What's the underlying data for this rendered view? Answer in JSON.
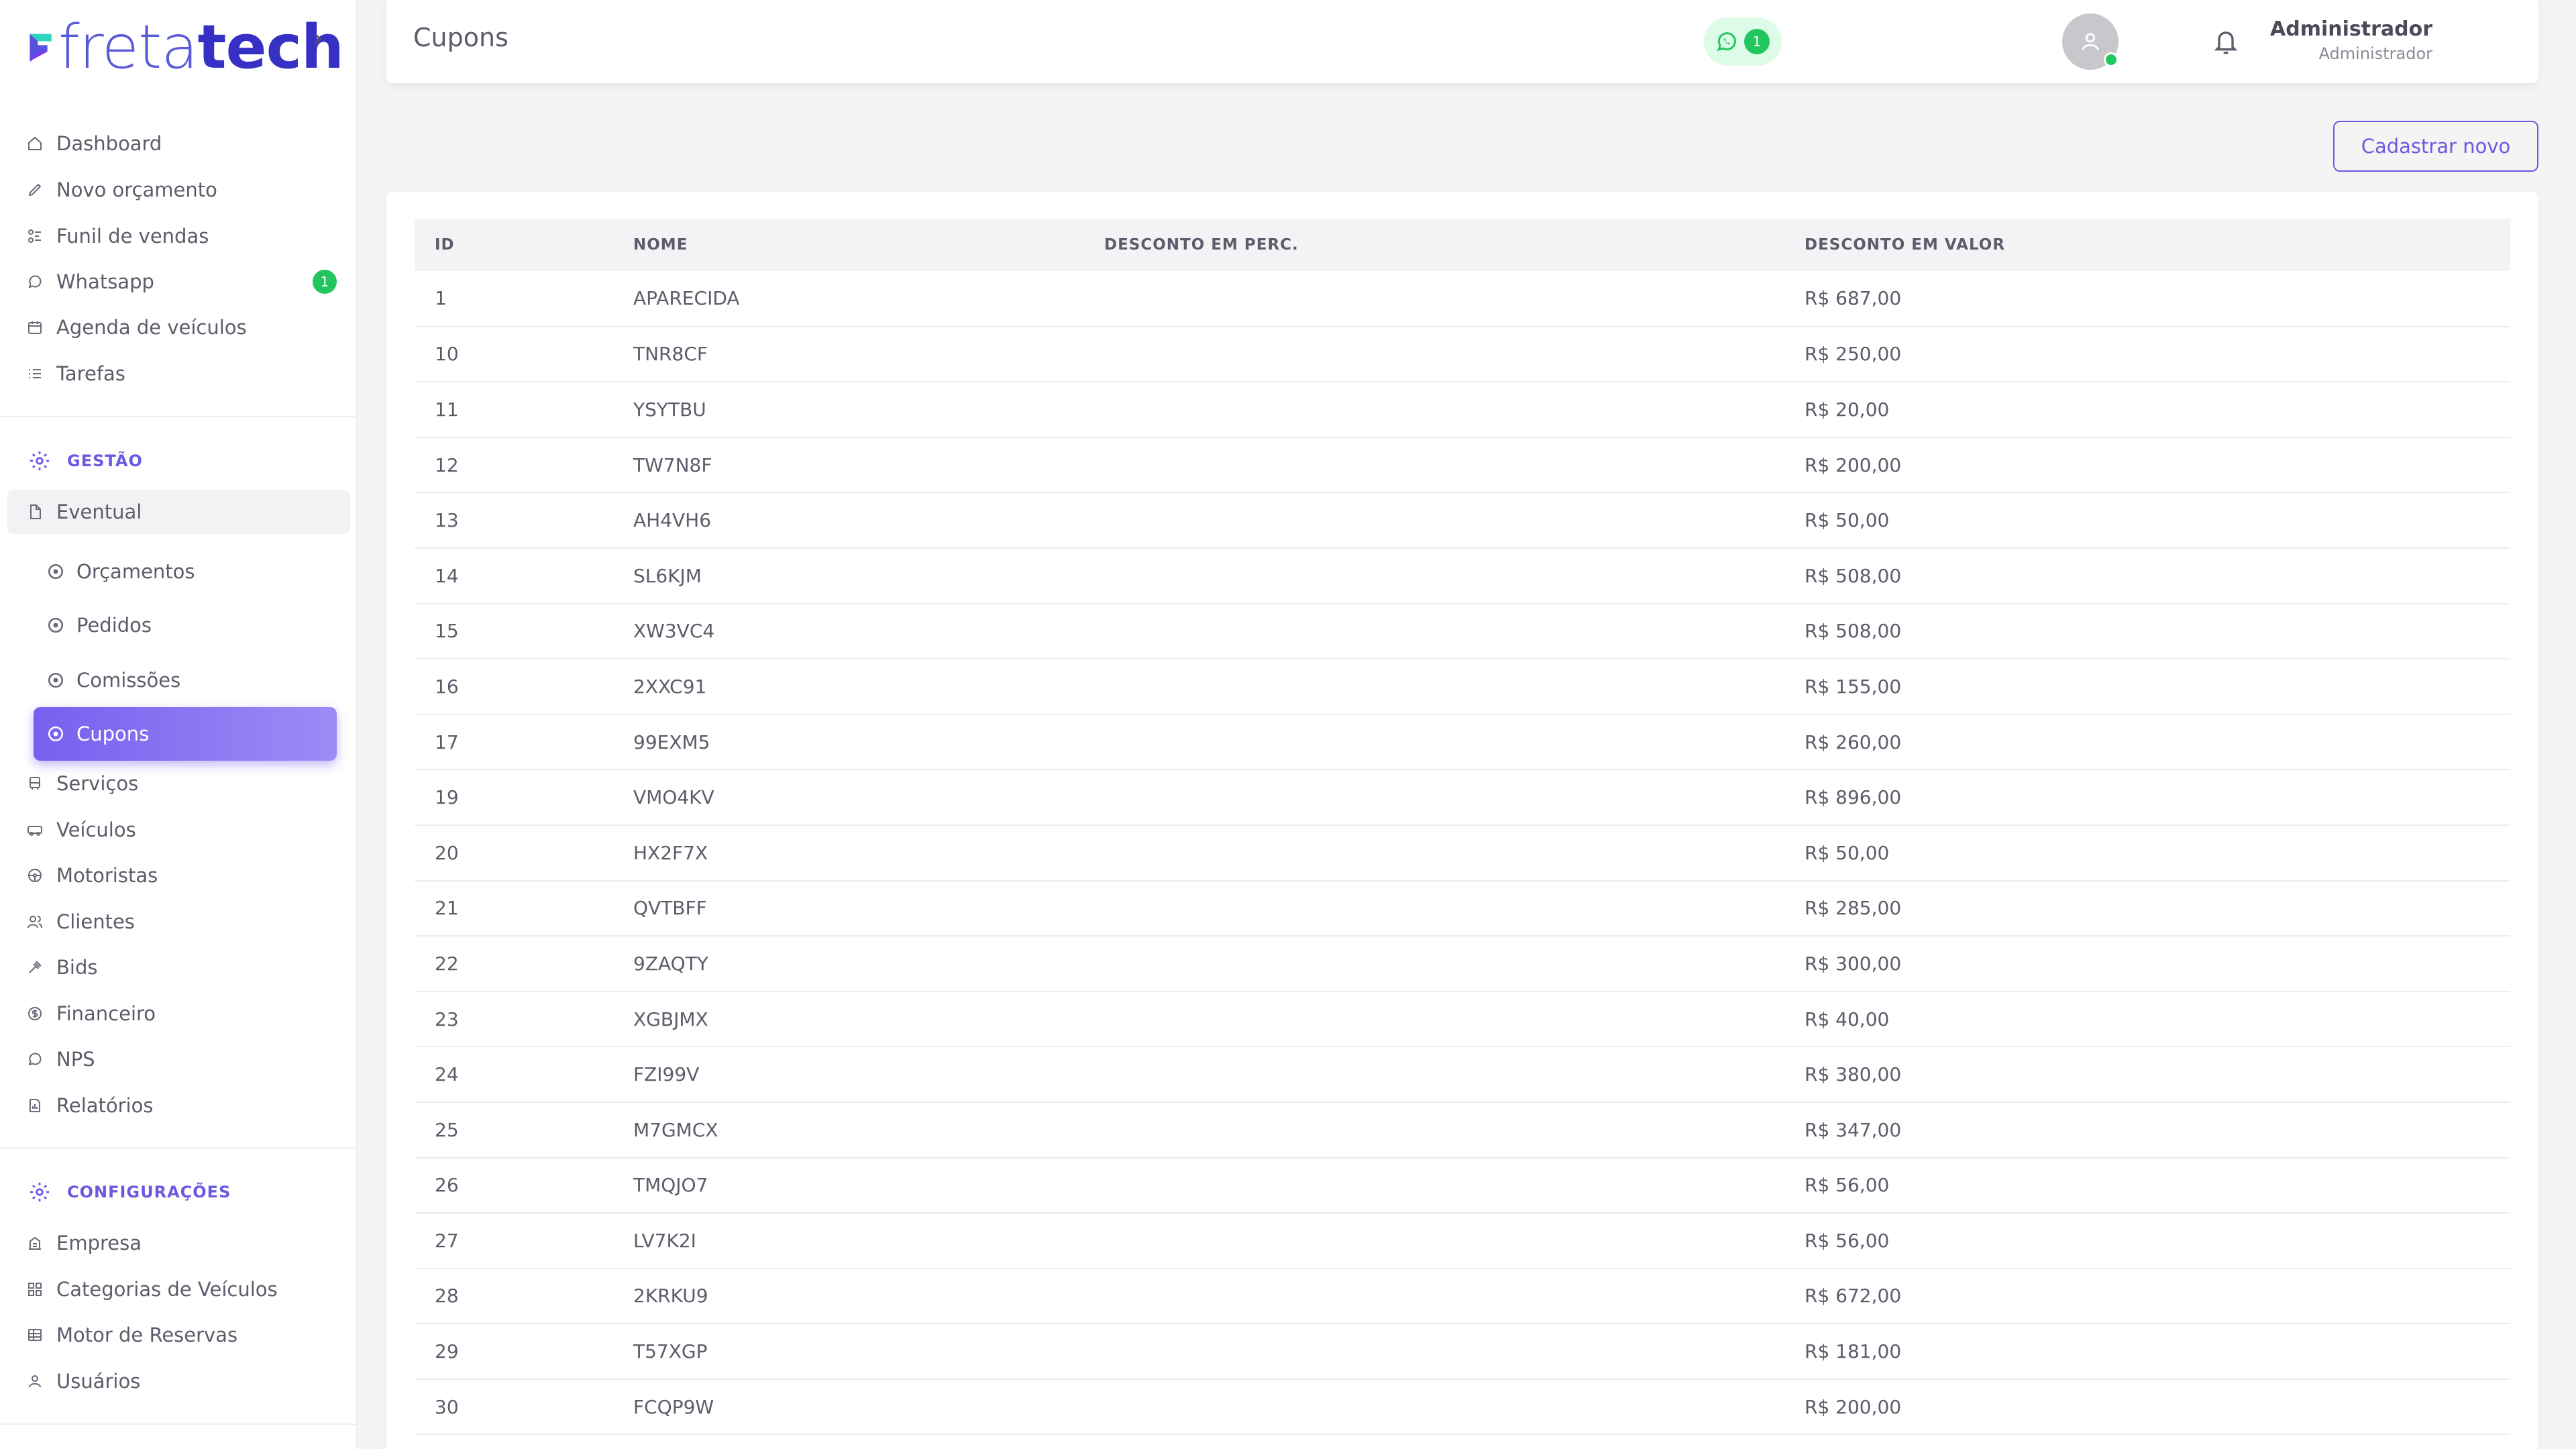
{
  "brand": {
    "name_part1": "freta",
    "name_part2": "tech",
    "accent": "#6a5ae0"
  },
  "sidebar": {
    "main_items": [
      {
        "label": "Dashboard",
        "icon": "home-icon"
      },
      {
        "label": "Novo orçamento",
        "icon": "edit-icon"
      },
      {
        "label": "Funil de vendas",
        "icon": "funnel-icon"
      },
      {
        "label": "Whatsapp",
        "icon": "whatsapp-icon",
        "badge": "1"
      },
      {
        "label": "Agenda de veículos",
        "icon": "calendar-icon"
      },
      {
        "label": "Tarefas",
        "icon": "list-icon"
      }
    ],
    "section_gestao": "GESTÃO",
    "eventual": "Eventual",
    "eventual_sub": [
      {
        "label": "Orçamentos",
        "icon": "circle-icon"
      },
      {
        "label": "Pedidos",
        "icon": "circle-icon"
      },
      {
        "label": "Comissões",
        "icon": "circle-icon"
      },
      {
        "label": "Cupons",
        "icon": "circle-icon",
        "active": true
      }
    ],
    "gestao_items": [
      {
        "label": "Serviços",
        "icon": "bus-icon"
      },
      {
        "label": "Veículos",
        "icon": "car-icon"
      },
      {
        "label": "Motoristas",
        "icon": "steering-wheel-icon"
      },
      {
        "label": "Clientes",
        "icon": "users-icon"
      },
      {
        "label": "Bids",
        "icon": "gavel-icon"
      },
      {
        "label": "Financeiro",
        "icon": "dollar-icon"
      },
      {
        "label": "NPS",
        "icon": "chat-icon"
      },
      {
        "label": "Relatórios",
        "icon": "report-icon"
      }
    ],
    "section_config": "CONFIGURAÇÕES",
    "config_items": [
      {
        "label": "Empresa",
        "icon": "building-icon"
      },
      {
        "label": "Categorias de Veículos",
        "icon": "grid-icon"
      },
      {
        "label": "Motor de Reservas",
        "icon": "table-icon"
      },
      {
        "label": "Usuários",
        "icon": "user-icon"
      }
    ]
  },
  "header": {
    "title": "Cupons",
    "whatsapp_count": "1",
    "user_name": "Administrador",
    "user_role": "Administrador"
  },
  "actions": {
    "new_button": "Cadastrar novo"
  },
  "table": {
    "columns": [
      "ID",
      "NOME",
      "DESCONTO EM PERC.",
      "DESCONTO EM VALOR"
    ],
    "rows": [
      [
        "1",
        "APARECIDA",
        "",
        "R$ 687,00"
      ],
      [
        "10",
        "TNR8CF",
        "",
        "R$ 250,00"
      ],
      [
        "11",
        "YSYTBU",
        "",
        "R$ 20,00"
      ],
      [
        "12",
        "TW7N8F",
        "",
        "R$ 200,00"
      ],
      [
        "13",
        "AH4VH6",
        "",
        "R$ 50,00"
      ],
      [
        "14",
        "SL6KJM",
        "",
        "R$ 508,00"
      ],
      [
        "15",
        "XW3VC4",
        "",
        "R$ 508,00"
      ],
      [
        "16",
        "2XXC91",
        "",
        "R$ 155,00"
      ],
      [
        "17",
        "99EXM5",
        "",
        "R$ 260,00"
      ],
      [
        "19",
        "VMO4KV",
        "",
        "R$ 896,00"
      ],
      [
        "20",
        "HX2F7X",
        "",
        "R$ 50,00"
      ],
      [
        "21",
        "QVTBFF",
        "",
        "R$ 285,00"
      ],
      [
        "22",
        "9ZAQTY",
        "",
        "R$ 300,00"
      ],
      [
        "23",
        "XGBJMX",
        "",
        "R$ 40,00"
      ],
      [
        "24",
        "FZI99V",
        "",
        "R$ 380,00"
      ],
      [
        "25",
        "M7GMCX",
        "",
        "R$ 347,00"
      ],
      [
        "26",
        "TMQJO7",
        "",
        "R$ 56,00"
      ],
      [
        "27",
        "LV7K2I",
        "",
        "R$ 56,00"
      ],
      [
        "28",
        "2KRKU9",
        "",
        "R$ 672,00"
      ],
      [
        "29",
        "T57XGP",
        "",
        "R$ 181,00"
      ],
      [
        "30",
        "FCQP9W",
        "",
        "R$ 200,00"
      ]
    ]
  }
}
